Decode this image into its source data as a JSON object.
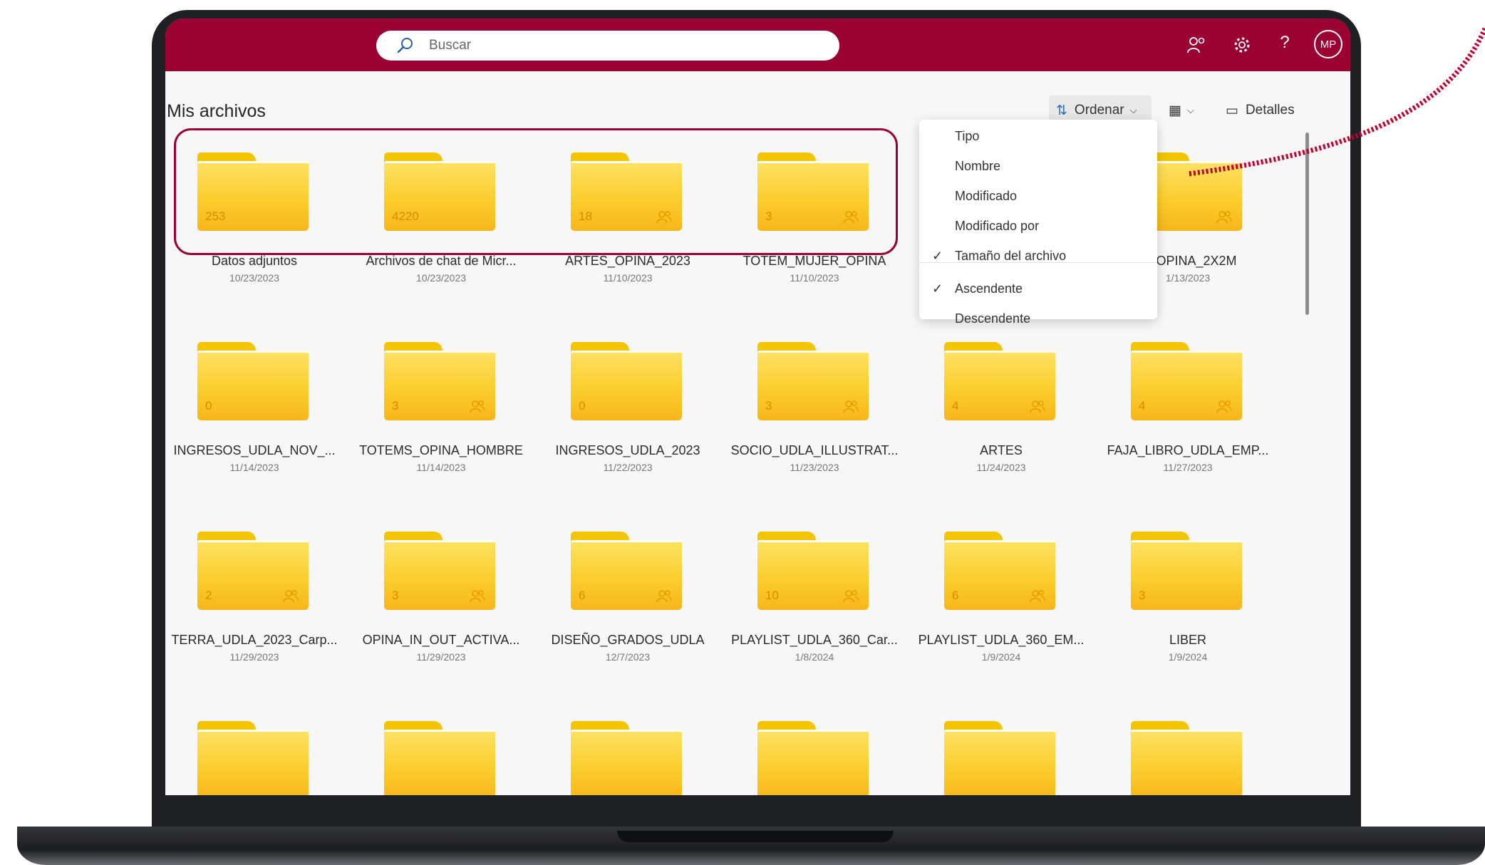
{
  "search": {
    "placeholder": "Buscar"
  },
  "header": {
    "icons": [
      "people-settings-icon",
      "gear-icon",
      "help-icon"
    ],
    "help_label": "?",
    "avatar_initials": "MP"
  },
  "page": {
    "title": "Mis archivos"
  },
  "commands": {
    "sort_label": "Ordenar",
    "details_label": "Detalles"
  },
  "sort_menu": {
    "items": [
      {
        "label": "Tipo",
        "checked": false
      },
      {
        "label": "Nombre",
        "checked": false
      },
      {
        "label": "Modificado",
        "checked": false
      },
      {
        "label": "Modificado por",
        "checked": false
      },
      {
        "label": "Tamaño del archivo",
        "checked": true
      },
      {
        "label": "Ascendente",
        "checked": true
      },
      {
        "label": "Descendente",
        "checked": false
      }
    ]
  },
  "folders": [
    {
      "name": "Datos adjuntos",
      "date": "10/23/2023",
      "count": "253",
      "shared": false
    },
    {
      "name": "Archivos de chat de Micr...",
      "date": "10/23/2023",
      "count": "4220",
      "shared": false
    },
    {
      "name": "ARTES_OPINA_2023",
      "date": "11/10/2023",
      "count": "18",
      "shared": true
    },
    {
      "name": "TOTEM_MUJER_OPINA",
      "date": "11/10/2023",
      "count": "3",
      "shared": true
    },
    {
      "name": "",
      "date": "",
      "count": "",
      "shared": false
    },
    {
      "name": "G_OPINA_2X2M",
      "date": "1/13/2023",
      "count": "",
      "shared": true
    },
    {
      "name": "INGRESOS_UDLA_NOV_...",
      "date": "11/14/2023",
      "count": "0",
      "shared": false
    },
    {
      "name": "TOTEMS_OPINA_HOMBRE",
      "date": "11/14/2023",
      "count": "3",
      "shared": true
    },
    {
      "name": "INGRESOS_UDLA_2023",
      "date": "11/22/2023",
      "count": "0",
      "shared": false
    },
    {
      "name": "SOCIO_UDLA_ILLUSTRAT...",
      "date": "11/23/2023",
      "count": "3",
      "shared": true
    },
    {
      "name": "ARTES",
      "date": "11/24/2023",
      "count": "4",
      "shared": true
    },
    {
      "name": "FAJA_LIBRO_UDLA_EMP...",
      "date": "11/27/2023",
      "count": "4",
      "shared": true
    },
    {
      "name": "TERRA_UDLA_2023_Carp...",
      "date": "11/29/2023",
      "count": "2",
      "shared": true
    },
    {
      "name": "OPINA_IN_OUT_ACTIVA...",
      "date": "11/29/2023",
      "count": "3",
      "shared": true
    },
    {
      "name": "DISEÑO_GRADOS_UDLA",
      "date": "12/7/2023",
      "count": "6",
      "shared": true
    },
    {
      "name": "PLAYLIST_UDLA_360_Car...",
      "date": "1/8/2024",
      "count": "10",
      "shared": true
    },
    {
      "name": "PLAYLIST_UDLA_360_EM...",
      "date": "1/9/2024",
      "count": "6",
      "shared": true
    },
    {
      "name": "LIBER",
      "date": "1/9/2024",
      "count": "3",
      "shared": false
    },
    {
      "name": "",
      "date": "",
      "count": "",
      "shared": false
    },
    {
      "name": "",
      "date": "",
      "count": "",
      "shared": false
    },
    {
      "name": "",
      "date": "",
      "count": "",
      "shared": false
    },
    {
      "name": "",
      "date": "",
      "count": "",
      "shared": false
    },
    {
      "name": "",
      "date": "",
      "count": "",
      "shared": false
    },
    {
      "name": "",
      "date": "",
      "count": "",
      "shared": false
    }
  ],
  "colors": {
    "brand": "#9b0032",
    "folder": "#fbcd2c",
    "arrow": "#c0002e"
  }
}
